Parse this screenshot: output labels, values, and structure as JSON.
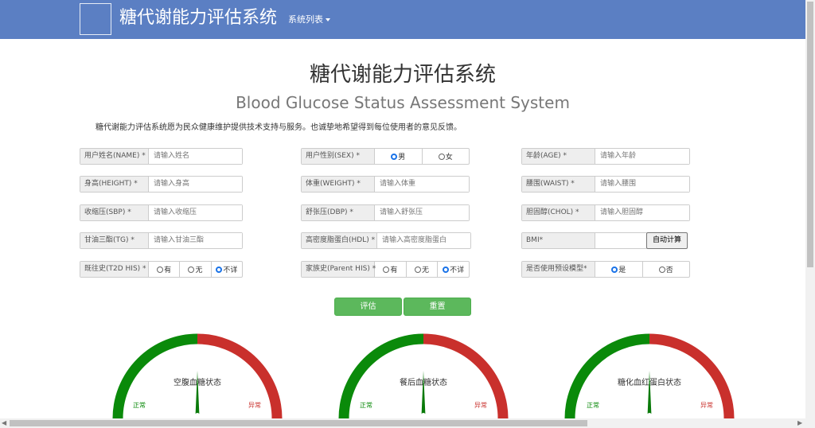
{
  "navbar": {
    "title": "糖代谢能力评估系统",
    "menu": "系统列表"
  },
  "header": {
    "title": "糖代谢能力评估系统",
    "subtitle": "Blood Glucose Status Assessment System",
    "intro": "糖代谢能力评估系统愿为民众健康维护提供技术支持与服务。也诚挚地希望得到每位使用者的意见反馈。"
  },
  "form": {
    "name": {
      "label": "用户姓名(NAME) *",
      "placeholder": "请输入姓名"
    },
    "sex": {
      "label": "用户性别(SEX) *",
      "options": [
        "男",
        "女"
      ],
      "selected": "男"
    },
    "age": {
      "label": "年龄(AGE) *",
      "placeholder": "请输入年龄"
    },
    "height": {
      "label": "身高(HEIGHT) *",
      "placeholder": "请输入身高"
    },
    "weight": {
      "label": "体重(WEIGHT) *",
      "placeholder": "请输入体重"
    },
    "waist": {
      "label": "腰围(WAIST) *",
      "placeholder": "请输入腰围"
    },
    "sbp": {
      "label": "收缩压(SBP) *",
      "placeholder": "请输入收缩压"
    },
    "dbp": {
      "label": "舒张压(DBP) *",
      "placeholder": "请输入舒张压"
    },
    "chol": {
      "label": "胆固醇(CHOL) *",
      "placeholder": "请输入胆固醇"
    },
    "tg": {
      "label": "甘油三酯(TG) *",
      "placeholder": "请输入甘油三酯"
    },
    "hdl": {
      "label": "高密度脂蛋白(HDL) *",
      "placeholder": "请输入高密度脂蛋白"
    },
    "bmi": {
      "label": "BMI*",
      "value": "",
      "button": "自动计算"
    },
    "t2d_his": {
      "label": "既往史(T2D HIS) *",
      "options": [
        "有",
        "无",
        "不详"
      ],
      "selected": "不详"
    },
    "parent_his": {
      "label": "家族史(Parent HIS) *",
      "options": [
        "有",
        "无",
        "不详"
      ],
      "selected": "不详"
    },
    "preset_model": {
      "label": "是否使用预设模型*",
      "options": [
        "是",
        "否"
      ],
      "selected": "是"
    }
  },
  "actions": {
    "evaluate": "评估",
    "reset": "重置"
  },
  "gauges": [
    {
      "title": "空腹血糖状态",
      "normal": "正常",
      "abnormal": "异常"
    },
    {
      "title": "餐后血糖状态",
      "normal": "正常",
      "abnormal": "异常"
    },
    {
      "title": "糖化血红蛋白状态",
      "normal": "正常",
      "abnormal": "异常"
    }
  ],
  "colors": {
    "navbar": "#5b7fc3",
    "normal": "#0a8a0a",
    "abnormal": "#c9302c",
    "button": "#5cb85c",
    "radio": "#1a73e8"
  },
  "icons": {
    "logo": "broken-image-icon",
    "menu_caret": "caret-down-icon"
  }
}
